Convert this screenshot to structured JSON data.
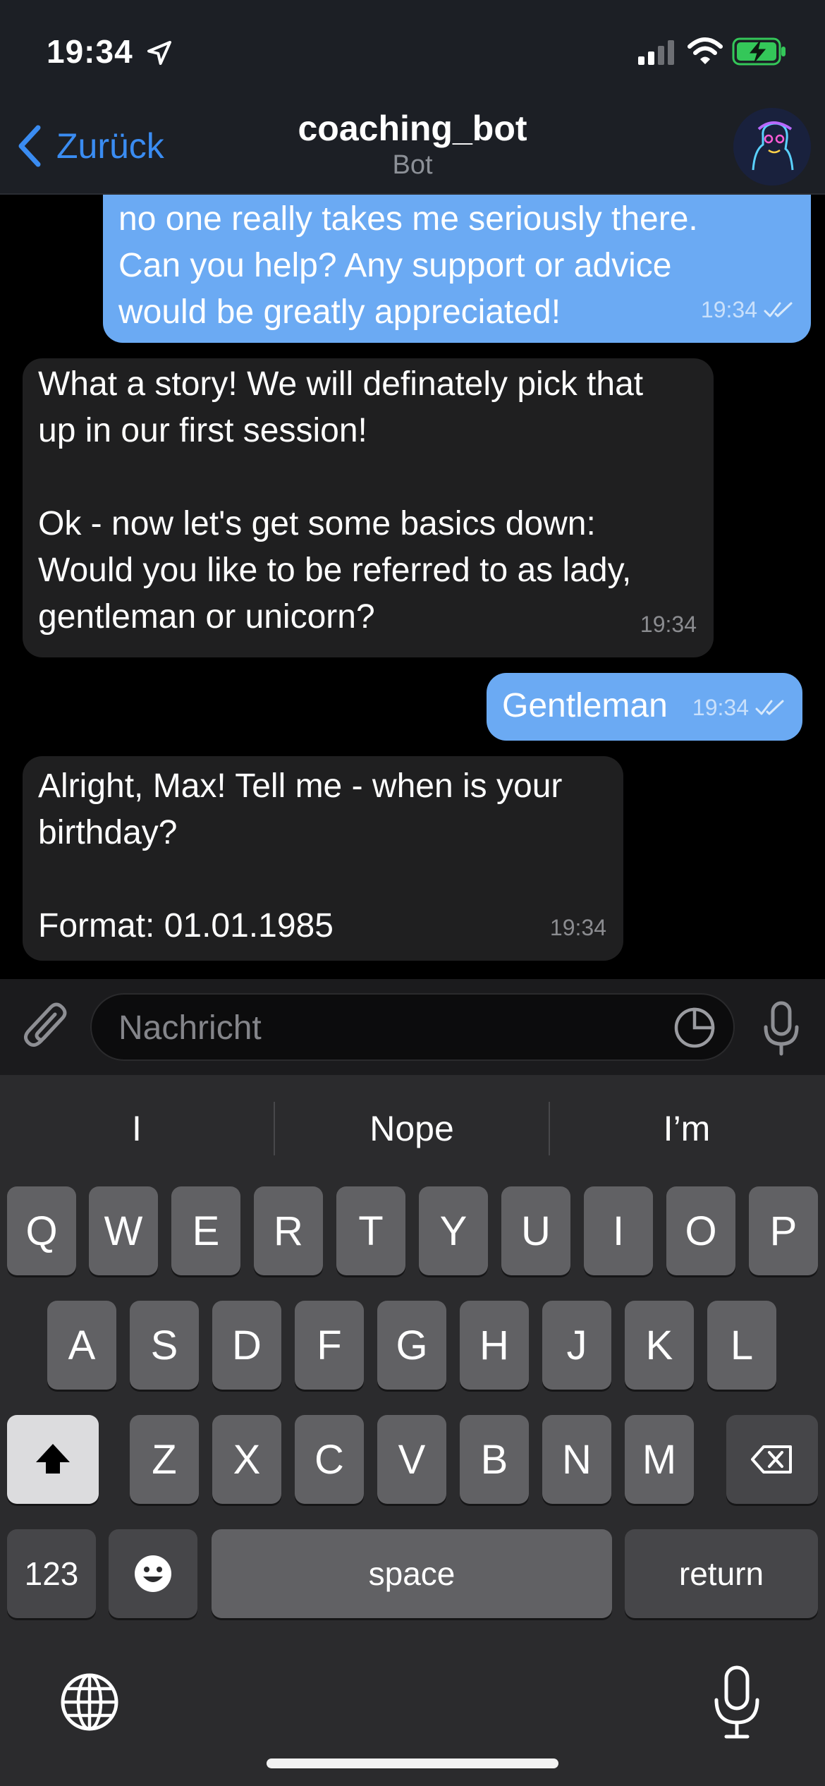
{
  "status_bar": {
    "time": "19:34"
  },
  "header": {
    "back_label": "Zurück",
    "title": "coaching_bot",
    "subtitle": "Bot"
  },
  "messages": [
    {
      "direction": "out",
      "text": "no one really takes me seriously there.\nCan you help? Any support or advice\nwould be greatly appreciated!",
      "time": "19:34",
      "read": true
    },
    {
      "direction": "in",
      "text": "What a story! We will definately pick that\nup in our first session!\n\nOk - now let's get some basics down:\nWould you like to be referred to as lady,\ngentleman or unicorn?",
      "time": "19:34"
    },
    {
      "direction": "out",
      "text": "Gentleman",
      "time": "19:34",
      "read": true
    },
    {
      "direction": "in",
      "text": "Alright, Max! Tell me - when is your\nbirthday?\n\nFormat: 01.01.1985",
      "time": "19:34"
    }
  ],
  "composer": {
    "placeholder": "Nachricht",
    "value": ""
  },
  "keyboard": {
    "suggestions": [
      "I",
      "Nope",
      "I’m"
    ],
    "row1": [
      "Q",
      "W",
      "E",
      "R",
      "T",
      "Y",
      "U",
      "I",
      "O",
      "P"
    ],
    "row2": [
      "A",
      "S",
      "D",
      "F",
      "G",
      "H",
      "J",
      "K",
      "L"
    ],
    "row3": [
      "Z",
      "X",
      "C",
      "V",
      "B",
      "N",
      "M"
    ],
    "numbers_label": "123",
    "space_label": "space",
    "return_label": "return",
    "icons": [
      "shift-icon",
      "backspace-icon",
      "emoji-icon",
      "globe-icon",
      "microphone-icon"
    ]
  },
  "colors": {
    "accent": "#3a8cf2",
    "outgoing_bubble": "#6baaf3",
    "incoming_bubble": "#1f1f20",
    "battery": "#34c759"
  }
}
